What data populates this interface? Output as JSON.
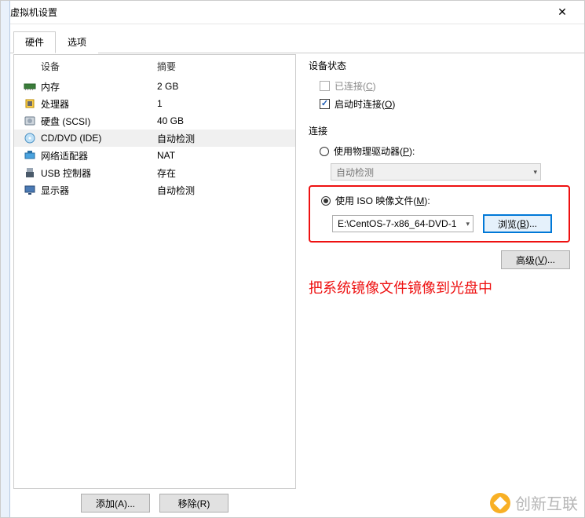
{
  "window": {
    "title": "虚拟机设置",
    "close_icon": "✕"
  },
  "tabs": {
    "hardware": "硬件",
    "options": "选项"
  },
  "list_header": {
    "device": "设备",
    "summary": "摘要"
  },
  "devices": [
    {
      "icon": "memory",
      "name": "内存",
      "summary": "2 GB",
      "selected": false
    },
    {
      "icon": "cpu",
      "name": "处理器",
      "summary": "1",
      "selected": false
    },
    {
      "icon": "hdd",
      "name": "硬盘 (SCSI)",
      "summary": "40 GB",
      "selected": false
    },
    {
      "icon": "cd",
      "name": "CD/DVD (IDE)",
      "summary": "自动检测",
      "selected": true
    },
    {
      "icon": "net",
      "name": "网络适配器",
      "summary": "NAT",
      "selected": false
    },
    {
      "icon": "usb",
      "name": "USB 控制器",
      "summary": "存在",
      "selected": false
    },
    {
      "icon": "display",
      "name": "显示器",
      "summary": "自动检测",
      "selected": false
    }
  ],
  "left_buttons": {
    "add": "添加(A)...",
    "remove": "移除(R)"
  },
  "right": {
    "status_label": "设备状态",
    "connected": {
      "label_pre": "已连接(",
      "hotkey": "C",
      "label_post": ")",
      "checked": false,
      "disabled": true
    },
    "connect_on": {
      "label_pre": "启动时连接(",
      "hotkey": "O",
      "label_post": ")",
      "checked": true,
      "disabled": false
    },
    "connection_label": "连接",
    "physical": {
      "label_pre": "使用物理驱动器(",
      "hotkey": "P",
      "label_post": "):",
      "selected": false
    },
    "physical_value": "自动检测",
    "iso": {
      "label_pre": "使用 ISO 映像文件(",
      "hotkey": "M",
      "label_post": "):",
      "selected": true
    },
    "iso_path": "E:\\CentOS-7-x86_64-DVD-1",
    "browse": {
      "label_pre": "浏览(",
      "hotkey": "B",
      "label_post": ")..."
    },
    "advanced": {
      "label_pre": "高级(",
      "hotkey": "V",
      "label_post": ")..."
    },
    "annotation": "把系统镜像文件镜像到光盘中"
  },
  "brand": "创新互联"
}
